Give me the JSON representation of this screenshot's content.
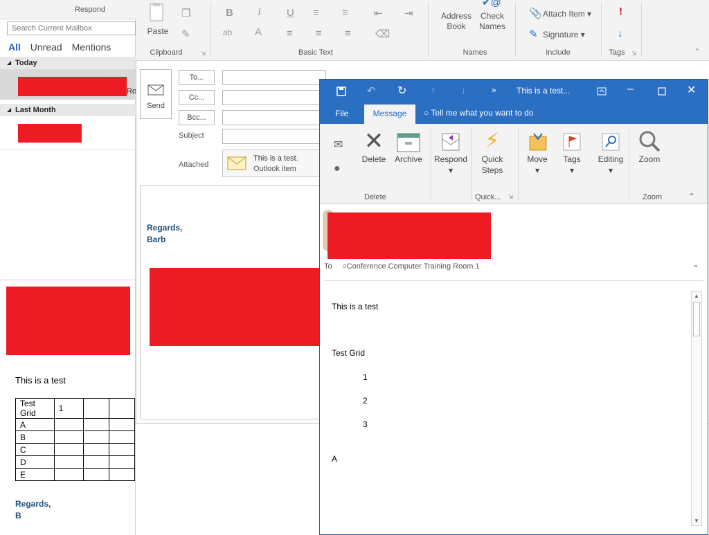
{
  "left_pane": {
    "respond_label": "Respond",
    "search_placeholder": "Search Current Mailbox",
    "filters": [
      "All",
      "Unread",
      "Mentions"
    ],
    "group_today": "Today",
    "group_last_month": "Last Month",
    "item_partial": "Ro",
    "body_text": "This is a test",
    "grid_header": [
      "Test Grid",
      "1",
      "",
      "",
      ""
    ],
    "grid_rows": [
      "A",
      "B",
      "C",
      "D",
      "E"
    ],
    "signature_line1": "Regards,",
    "signature_line2": "B"
  },
  "compose": {
    "ribbon": {
      "paste": "Paste",
      "group_clipboard": "Clipboard",
      "group_basic_text": "Basic Text",
      "address_book": "Address Book",
      "check_names": "Check Names",
      "group_names": "Names",
      "attach_item": "Attach Item",
      "signature": "Signature",
      "group_include": "Include",
      "group_tags": "Tags"
    },
    "send_label": "Send",
    "to_btn": "To...",
    "cc_btn": "Cc...",
    "bcc_btn": "Bcc...",
    "subject_label": "Subject",
    "attached_label": "Attached",
    "attachment_name": "This is a test.",
    "attachment_type": "Outlook item",
    "signature_line1": "Regards,",
    "signature_line2": "Barb"
  },
  "reader": {
    "title": "This is a test...",
    "tabs": {
      "file": "File",
      "message": "Message",
      "tell_me": "Tell me what you want to do"
    },
    "ribbon": {
      "delete": "Delete",
      "archive": "Archive",
      "group_delete": "Delete",
      "respond": "Respond",
      "quick_steps": "Quick Steps",
      "group_quick": "Quick...",
      "move": "Move",
      "tags": "Tags",
      "editing": "Editing",
      "zoom": "Zoom",
      "group_zoom": "Zoom"
    },
    "to_label": "To",
    "to_value": "Conference Computer Training Room 1",
    "body": {
      "line1": "This is a test",
      "grid_title": "Test Grid",
      "n1": "1",
      "n2": "2",
      "n3": "3",
      "a": "A"
    }
  },
  "colors": {
    "accent": "#2b6fc2",
    "redaction": "#ed1c24",
    "link_blue": "#1f4e79"
  }
}
